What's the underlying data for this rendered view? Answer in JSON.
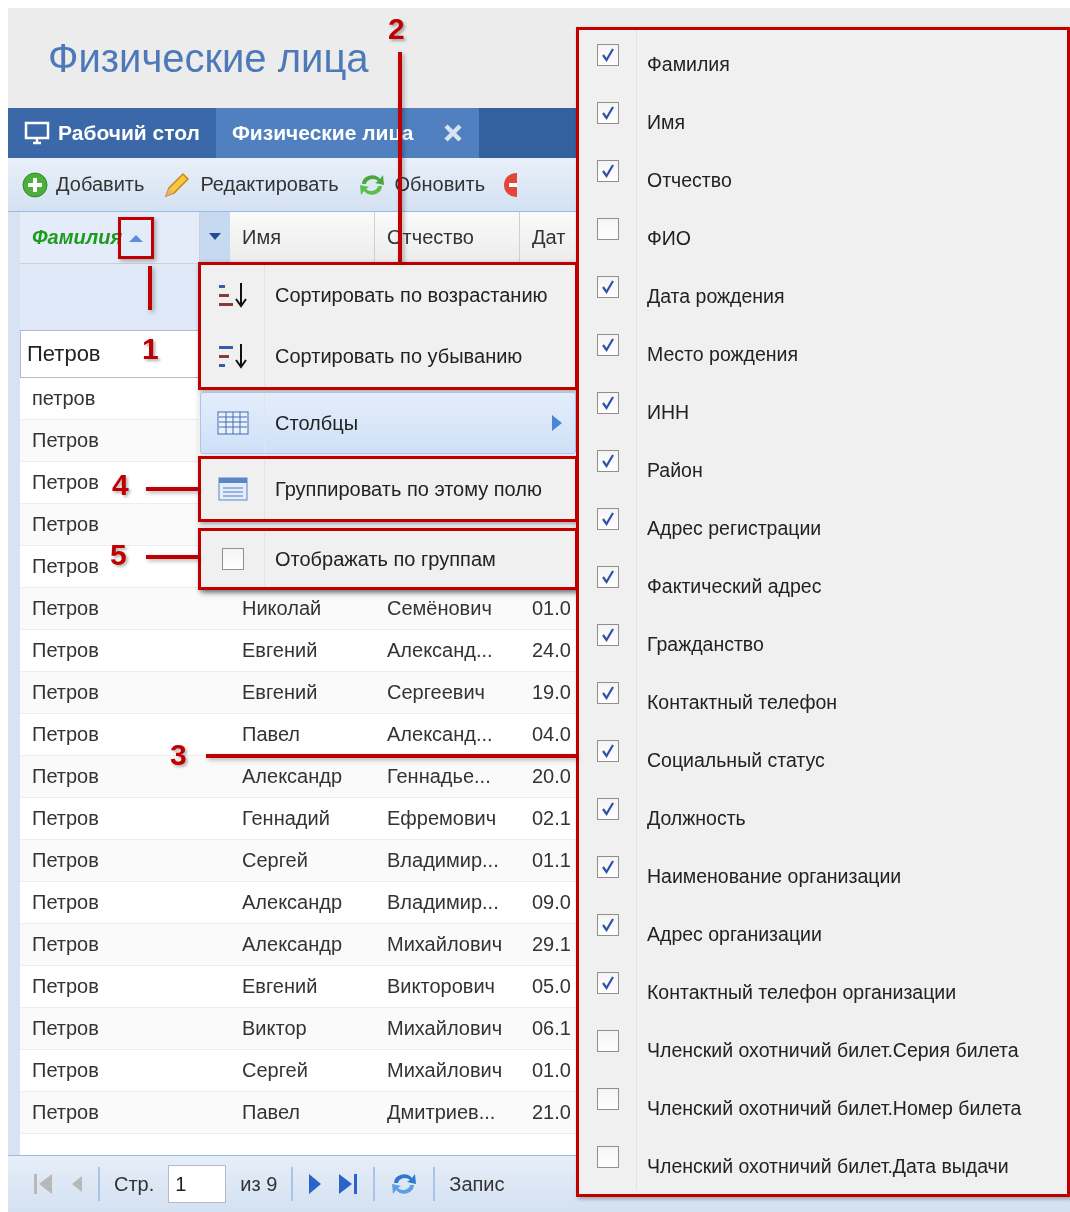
{
  "page_title": "Физические лица",
  "tabs": [
    {
      "label": "Рабочий стол",
      "selected": false,
      "closable": false
    },
    {
      "label": "Физические лица",
      "selected": true,
      "closable": true
    }
  ],
  "toolbar": [
    {
      "kind": "add",
      "label": "Добавить"
    },
    {
      "kind": "edit",
      "label": "Редактировать"
    },
    {
      "kind": "refresh",
      "label": "Обновить"
    },
    {
      "kind": "delete"
    }
  ],
  "columns": [
    {
      "label": "Фамилия",
      "sorted": true
    },
    {
      "label": "Имя",
      "sorted": false
    },
    {
      "label": "Отчество",
      "sorted": false
    },
    {
      "label": "Дат",
      "sorted": false
    }
  ],
  "filter": {
    "value": "Петров"
  },
  "rows": [
    {
      "cells": [
        "петров"
      ]
    },
    {
      "cells": [
        "Петров"
      ]
    },
    {
      "cells": [
        "Петров"
      ]
    },
    {
      "cells": [
        "Петров"
      ]
    },
    {
      "cells": [
        "Петров"
      ]
    },
    {
      "cells": [
        "Петров",
        "Николай",
        "Семёнович",
        "01.0"
      ]
    },
    {
      "cells": [
        "Петров",
        "Евгений",
        "Александ...",
        "24.0"
      ]
    },
    {
      "cells": [
        "Петров",
        "Евгений",
        "Сергеевич",
        "19.0"
      ]
    },
    {
      "cells": [
        "Петров",
        "Павел",
        "Александ...",
        "04.0"
      ]
    },
    {
      "cells": [
        "Петров",
        "Александр",
        "Геннадье...",
        "20.0"
      ]
    },
    {
      "cells": [
        "Петров",
        "Геннадий",
        "Ефремович",
        "02.1"
      ]
    },
    {
      "cells": [
        "Петров",
        "Сергей",
        "Владимир...",
        "01.1"
      ]
    },
    {
      "cells": [
        "Петров",
        "Александр",
        "Владимир...",
        "09.0"
      ]
    },
    {
      "cells": [
        "Петров",
        "Александр",
        "Михайлович",
        "29.1"
      ]
    },
    {
      "cells": [
        "Петров",
        "Евгений",
        "Викторович",
        "05.0"
      ]
    },
    {
      "cells": [
        "Петров",
        "Виктор",
        "Михайлович",
        "06.1"
      ]
    },
    {
      "cells": [
        "Петров",
        "Сергей",
        "Михайлович",
        "01.0"
      ]
    },
    {
      "cells": [
        "Петров",
        "Павел",
        "Дмитриев...",
        "21.0"
      ]
    }
  ],
  "pager": [
    {
      "kind": "first",
      "disabled": true
    },
    {
      "kind": "prev",
      "disabled": true
    },
    {
      "kind": "sep"
    },
    {
      "kind": "text",
      "label": "Стр."
    },
    {
      "kind": "input",
      "value": "1"
    },
    {
      "kind": "text",
      "label": "из 9"
    },
    {
      "kind": "sep"
    },
    {
      "kind": "next",
      "disabled": false
    },
    {
      "kind": "last",
      "disabled": false
    },
    {
      "kind": "sep"
    },
    {
      "kind": "refresh"
    },
    {
      "kind": "sep"
    },
    {
      "kind": "text",
      "label": "Запис"
    }
  ],
  "column_menu": [
    {
      "kind": "sort_asc",
      "label": "Сортировать по возрастанию",
      "selected": false
    },
    {
      "kind": "sort_desc",
      "label": "Сортировать по убыванию",
      "selected": false
    },
    {
      "kind": "submenu",
      "label": "Столбцы",
      "selected": true
    },
    {
      "kind": "group",
      "label": "Группировать по этому полю",
      "selected": false
    },
    {
      "kind": "checkbox",
      "label": "Отображать по группам",
      "selected": false,
      "checked": false
    }
  ],
  "columns_menu": [
    {
      "label": "Фамилия",
      "checked": true
    },
    {
      "label": "Имя",
      "checked": true
    },
    {
      "label": "Отчество",
      "checked": true
    },
    {
      "label": "ФИО",
      "checked": false
    },
    {
      "label": "Дата рождения",
      "checked": true
    },
    {
      "label": "Место рождения",
      "checked": true
    },
    {
      "label": "ИНН",
      "checked": true
    },
    {
      "label": "Район",
      "checked": true
    },
    {
      "label": "Адрес регистрации",
      "checked": true
    },
    {
      "label": "Фактический адрес",
      "checked": true
    },
    {
      "label": "Гражданство",
      "checked": true
    },
    {
      "label": "Контактный телефон",
      "checked": true
    },
    {
      "label": "Социальный статус",
      "checked": true
    },
    {
      "label": "Должность",
      "checked": true
    },
    {
      "label": "Наименование организации",
      "checked": true
    },
    {
      "label": "Адрес организации",
      "checked": true
    },
    {
      "label": "Контактный телефон организации",
      "checked": true
    },
    {
      "label": "Членский охотничий билет.Серия билета",
      "checked": false
    },
    {
      "label": "Членский охотничий билет.Номер билета",
      "checked": false
    },
    {
      "label": "Членский охотничий билет.Дата выдачи",
      "checked": false
    }
  ],
  "annotations": [
    "1",
    "2",
    "3",
    "4",
    "5"
  ]
}
